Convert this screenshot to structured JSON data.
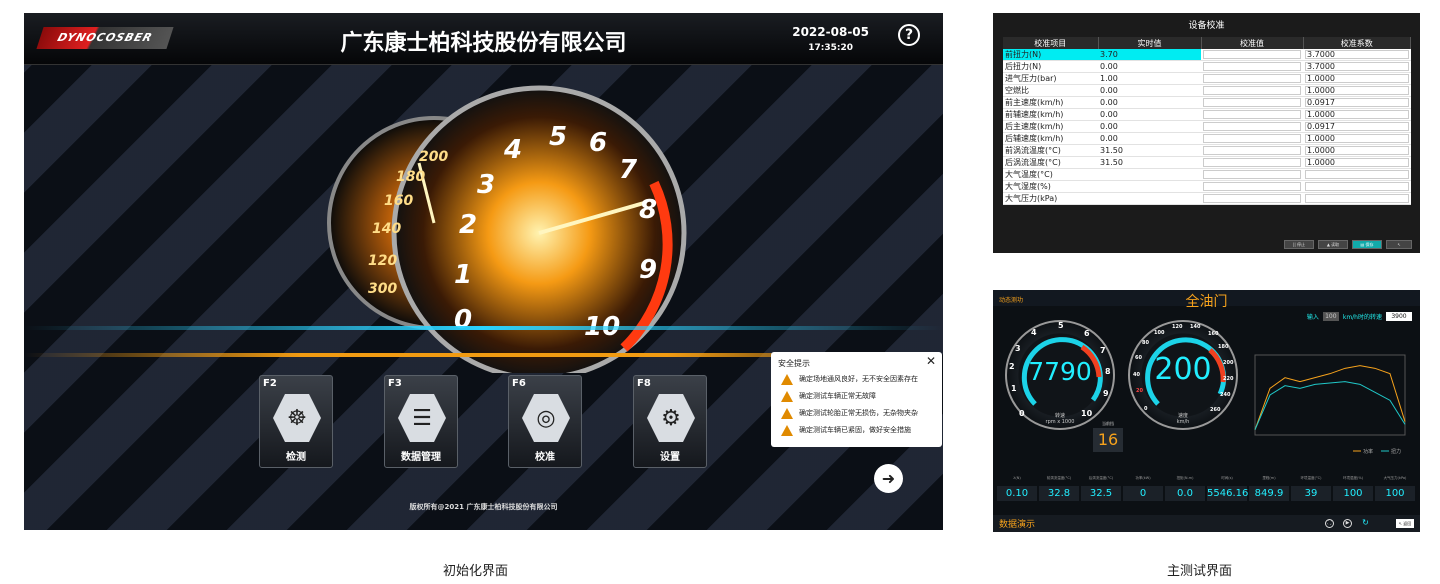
{
  "init": {
    "logo": "DYNOCOSBER",
    "title": "广东康士柏科技股份有限公司",
    "date": "2022-08-05",
    "time": "17:35:20",
    "help_icon": "question-circle-icon",
    "dial_back_numbers": [
      "200",
      "180",
      "160",
      "140",
      "120",
      "300"
    ],
    "dial_front_numbers": [
      "4",
      "5",
      "6",
      "7",
      "8",
      "9",
      "10",
      "1",
      "2",
      "3",
      "0"
    ],
    "fkeys": [
      {
        "key": "F2",
        "label": "检测",
        "icon": "steering-wheel-icon"
      },
      {
        "key": "F3",
        "label": "数据管理",
        "icon": "list-icon"
      },
      {
        "key": "F6",
        "label": "校准",
        "icon": "target-icon"
      },
      {
        "key": "F8",
        "label": "设置",
        "icon": "gear-icon"
      }
    ],
    "safety": {
      "title": "安全提示",
      "items": [
        "确定场地通风良好，无不安全因素存在",
        "确定测试车辆正常无故障",
        "确定测试轮胎正常无损伤，无杂物夹杂",
        "确定测试车辆已紧固，做好安全措施"
      ]
    },
    "exit_icon": "exit-arrow-icon",
    "copyright": "版权所有@2021 广东康士柏科技股份有限公司",
    "caption": "初始化界面"
  },
  "calib": {
    "title": "设备校准",
    "columns": [
      "校准项目",
      "实时值",
      "校准值",
      "校准系数"
    ],
    "rows": [
      [
        "前扭力(N)",
        "3.70",
        "",
        "3.7000"
      ],
      [
        "后扭力(N)",
        "0.00",
        "",
        "3.7000"
      ],
      [
        "进气压力(bar)",
        "1.00",
        "",
        "1.0000"
      ],
      [
        "空燃比",
        "0.00",
        "",
        "1.0000"
      ],
      [
        "前主速度(km/h)",
        "0.00",
        "",
        "0.0917"
      ],
      [
        "前辅速度(km/h)",
        "0.00",
        "",
        "1.0000"
      ],
      [
        "后主速度(km/h)",
        "0.00",
        "",
        "0.0917"
      ],
      [
        "后辅速度(km/h)",
        "0.00",
        "",
        "1.0000"
      ],
      [
        "前涡流温度(°C)",
        "31.50",
        "",
        "1.0000"
      ],
      [
        "后涡流温度(°C)",
        "31.50",
        "",
        "1.0000"
      ],
      [
        "大气温度(°C)",
        "",
        "",
        ""
      ],
      [
        "大气湿度(%)",
        "",
        "",
        ""
      ],
      [
        "大气压力(kPa)",
        "",
        "",
        ""
      ]
    ],
    "buttons": [
      "|| 停止",
      "▲ 读取",
      "▤ 保存",
      "↖"
    ]
  },
  "main": {
    "tag": "动态测功",
    "title": "全油门",
    "input_label": "输入",
    "input_value": "100",
    "speed_label": "km/h时的转速",
    "speed_value": "3900",
    "rpm_gauge": {
      "value": "7790",
      "label": "转速",
      "unit": "rpm x 1000",
      "ticks": [
        "0",
        "1",
        "2",
        "3",
        "4",
        "5",
        "6",
        "7",
        "8",
        "9",
        "10"
      ]
    },
    "speed_gauge": {
      "value": "200",
      "label": "速度",
      "unit": "km/h",
      "ticks": [
        "0",
        "20",
        "40",
        "60",
        "80",
        "100",
        "120",
        "140",
        "160",
        "180",
        "200",
        "220",
        "240",
        "260"
      ]
    },
    "shift_label": "当前挡",
    "shift_value": "16",
    "stats": [
      {
        "label": "λ(N)",
        "value": "0.10"
      },
      {
        "label": "前涡流温度(°C)",
        "value": "32.8"
      },
      {
        "label": "后涡流温度(°C)",
        "value": "32.5"
      },
      {
        "label": "功率(kW)",
        "value": "0"
      },
      {
        "label": "扭矩(N.m)",
        "value": "0.0"
      },
      {
        "label": "时间(s)",
        "value": "5546.16"
      },
      {
        "label": "里程(m)",
        "value": "849.9"
      },
      {
        "label": "环境温度(°C)",
        "value": "39"
      },
      {
        "label": "环境湿度(%)",
        "value": "100"
      },
      {
        "label": "大气压力(kPa)",
        "value": "100"
      }
    ],
    "footer": "数据演示",
    "footer_icons": [
      "fullscreen-icon",
      "play-icon",
      "refresh-icon"
    ],
    "back_label": "↖ 返回",
    "chart_legend": [
      "功率",
      "扭力"
    ],
    "caption": "主测试界面"
  },
  "chart_data": {
    "type": "line",
    "x": [
      1000,
      1250,
      1500,
      1750,
      2000,
      2250,
      2500,
      2750,
      3000,
      3250,
      3500
    ],
    "series": [
      {
        "name": "功率",
        "values": [
          20,
          175,
          215,
          200,
          215,
          230,
          250,
          260,
          250,
          230,
          50
        ]
      },
      {
        "name": "扭力",
        "values": [
          20,
          150,
          185,
          175,
          190,
          195,
          200,
          190,
          160,
          130,
          40
        ]
      }
    ],
    "colors": [
      "#f6a21c",
      "#20c8c8"
    ]
  }
}
